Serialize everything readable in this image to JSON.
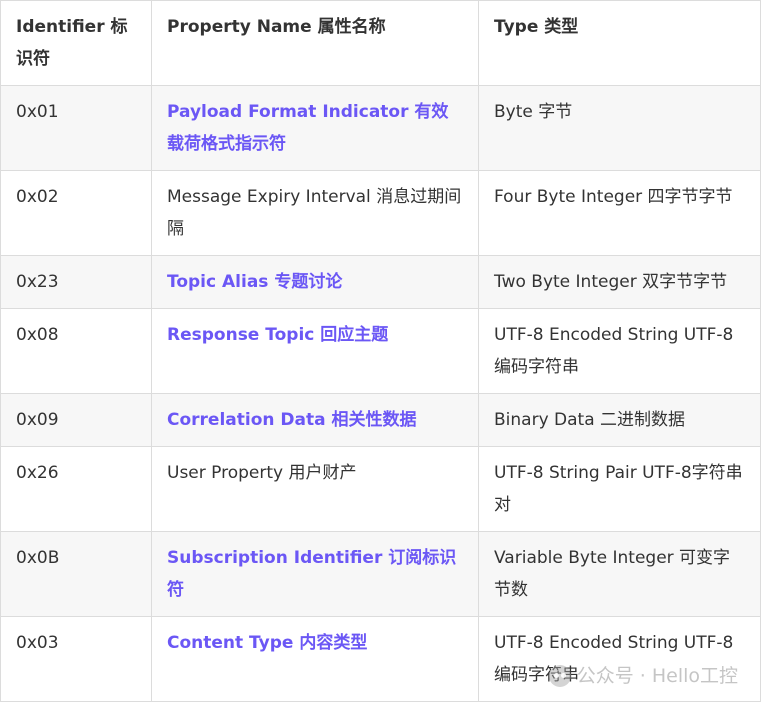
{
  "table": {
    "headers": {
      "identifier": "Identifier  标识符",
      "property_name": "Property Name  属性名称",
      "type": "Type  类型"
    },
    "rows": [
      {
        "id": "0x01",
        "name": "Payload Format Indicator  有效载荷格式指示符",
        "type": "Byte  字节"
      },
      {
        "id": "0x02",
        "name": "Message Expiry Interval  消息过期间隔",
        "type": "Four Byte Integer  四字节字节"
      },
      {
        "id": "0x23",
        "name": "Topic Alias  专题讨论",
        "type": "Two Byte Integer  双字节字节"
      },
      {
        "id": "0x08",
        "name": "Response Topic  回应主题",
        "type": "UTF-8 Encoded String  UTF-8 编码字符串"
      },
      {
        "id": "0x09",
        "name": "Correlation Data  相关性数据",
        "type": "Binary Data  二进制数据"
      },
      {
        "id": "0x26",
        "name": "User Property  用户财产",
        "type": "UTF-8 String Pair  UTF-8字符串对"
      },
      {
        "id": "0x0B",
        "name": "Subscription Identifier  订阅标识符",
        "type": "Variable Byte Integer  可变字节数"
      },
      {
        "id": "0x03",
        "name": "Content Type  内容类型",
        "type": "UTF-8 Encoded String  UTF-8 编码字符串"
      }
    ]
  },
  "watermark": {
    "text": "公众号 · Hello工控"
  },
  "colors": {
    "link": "#6b57f5",
    "text": "#333333",
    "border": "#dcdcdc",
    "stripe": "#f7f7f7"
  }
}
